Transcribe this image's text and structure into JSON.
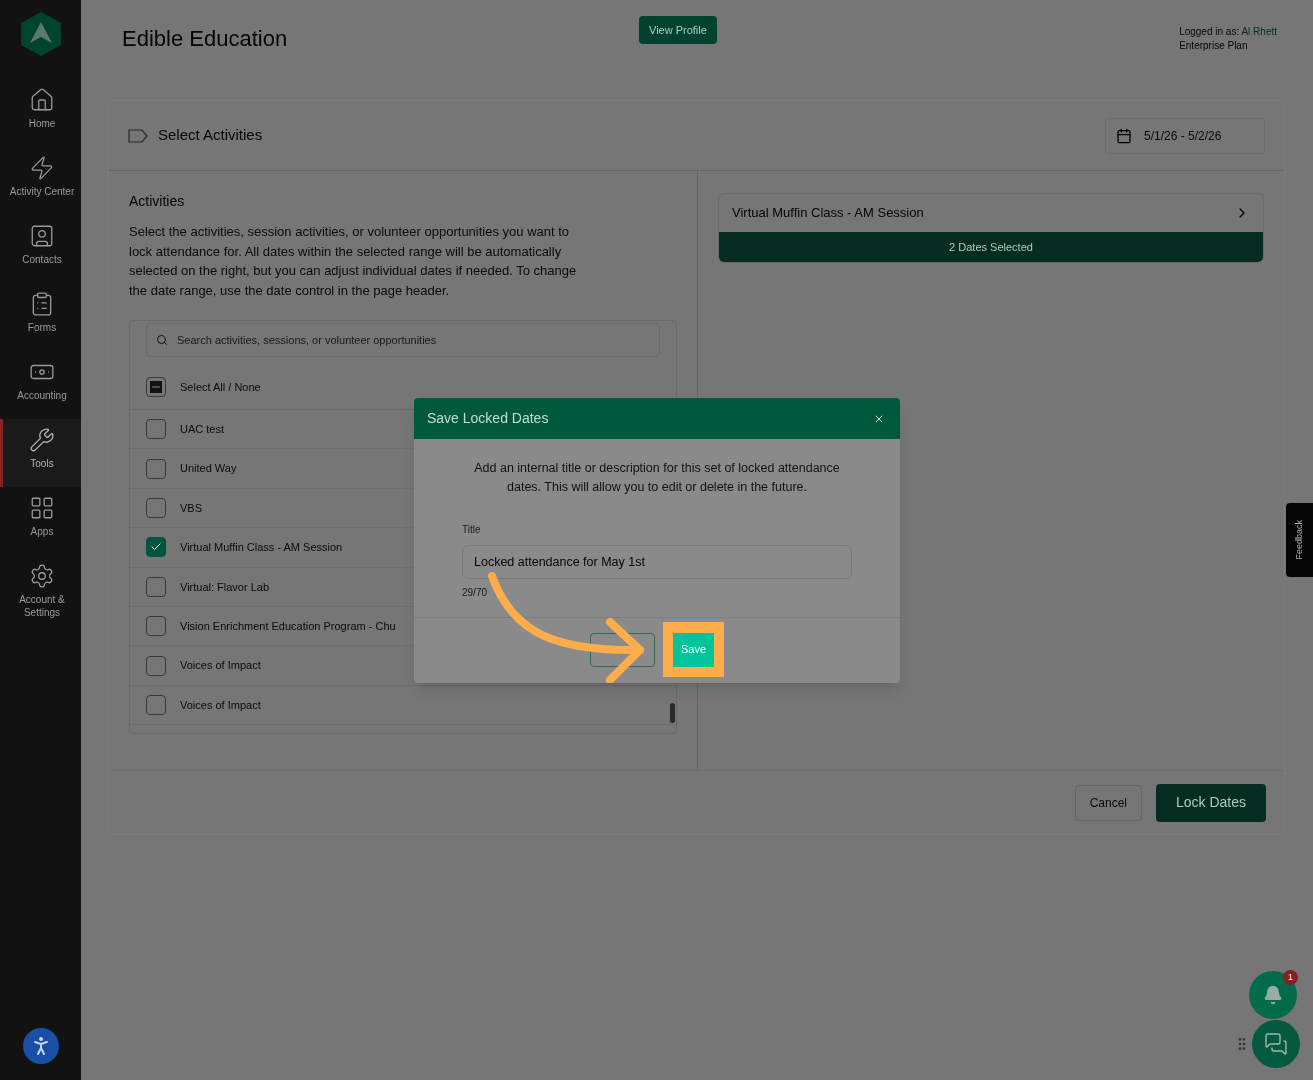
{
  "sidebar": {
    "items": [
      {
        "label": "Home",
        "selected": false
      },
      {
        "label": "Activity Center",
        "selected": false
      },
      {
        "label": "Contacts",
        "selected": false
      },
      {
        "label": "Forms",
        "selected": false
      },
      {
        "label": "Accounting",
        "selected": false
      },
      {
        "label": "Tools",
        "selected": true
      },
      {
        "label": "Apps",
        "selected": false
      },
      {
        "label": "Account & Settings",
        "selected": false
      }
    ]
  },
  "header": {
    "title": "Edible Education",
    "view_profile": "View Profile",
    "logged_in_label": "Logged in as:",
    "user": "Al Rhett",
    "plan": "Enterprise Plan"
  },
  "section": {
    "title": "Select Activities",
    "date_range": "5/1/26 - 5/2/26"
  },
  "activities": {
    "heading": "Activities",
    "description": "Select the activities, session activities, or volunteer opportunities you want to lock attendance for. All dates within the selected range will be automatically selected on the right, but you can adjust individual dates if needed. To change the date range, use the date control in the page header.",
    "search_placeholder": "Search activities, sessions, or volunteer opportunities",
    "select_all": {
      "label": "Select All / None",
      "indeterminate": true
    },
    "items": [
      {
        "label": "UAC test",
        "checked": false
      },
      {
        "label": "United Way",
        "checked": false
      },
      {
        "label": "VBS",
        "checked": false
      },
      {
        "label": "Virtual Muffin Class - AM Session",
        "checked": true
      },
      {
        "label": "Virtual: Flavor Lab",
        "checked": false
      },
      {
        "label": "Vision Enrichment Education Program - Chu",
        "checked": false
      },
      {
        "label": "Voices of Impact",
        "checked": false
      },
      {
        "label": "Voices of Impact",
        "checked": false
      }
    ]
  },
  "selected_panel": {
    "items": [
      {
        "name": "Virtual Muffin Class - AM Session",
        "badge": "2 Dates Selected"
      }
    ]
  },
  "footer": {
    "cancel": "Cancel",
    "lock": "Lock Dates"
  },
  "dialog": {
    "title": "Save Locked Dates",
    "message": "Add an internal title or description for this set of locked attendance dates. This will allow you to edit or delete in the future.",
    "field_label": "Title",
    "value": "Locked attendance for May 1st",
    "counter": "29/70",
    "save": "Save"
  },
  "feedback": "Feedback",
  "notifications": {
    "count": "1"
  }
}
